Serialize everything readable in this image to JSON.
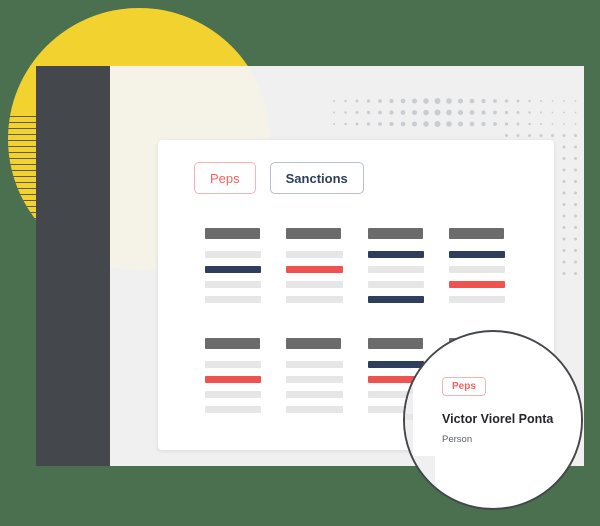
{
  "background_color": "#4a7050",
  "decor": {
    "sun_color": "#f2d22e",
    "sidebar_color": "#44474b",
    "panel_color": "#f0f0f0",
    "dot_color": "#c9ccd1"
  },
  "card": {
    "tabs": [
      {
        "label": "Peps",
        "state": "active",
        "color": "#f4635e"
      },
      {
        "label": "Sanctions",
        "state": "inactive",
        "color": "#2e3e5c"
      }
    ],
    "placeholder_grid": {
      "colors": {
        "gray": "#e6e6e6",
        "navy": "#2e3e5c",
        "red": "#ef5350",
        "header": "#6b6b6b"
      },
      "row_groups": [
        {
          "columns": [
            {
              "header": true,
              "bars": [
                "gray",
                "navy",
                "gray",
                "gray"
              ]
            },
            {
              "header": true,
              "bars": [
                "gray",
                "red",
                "gray",
                "gray"
              ]
            },
            {
              "header": true,
              "bars": [
                "navy",
                "gray",
                "gray",
                "navy"
              ]
            },
            {
              "header": true,
              "bars": [
                "navy",
                "gray",
                "red",
                "gray"
              ]
            }
          ]
        },
        {
          "columns": [
            {
              "header": true,
              "bars": [
                "gray",
                "red",
                "gray",
                "gray"
              ]
            },
            {
              "header": true,
              "bars": [
                "gray",
                "gray",
                "gray",
                "gray"
              ]
            },
            {
              "header": true,
              "bars": [
                "navy",
                "red",
                "gray",
                "gray"
              ]
            },
            {
              "header": true,
              "bars": [
                "gray",
                "red",
                "gray",
                "gray"
              ]
            }
          ]
        }
      ]
    }
  },
  "magnifier": {
    "badge": "Peps",
    "name": "Victor Viorel Ponta",
    "role": "Person",
    "border_color": "#44474b"
  }
}
